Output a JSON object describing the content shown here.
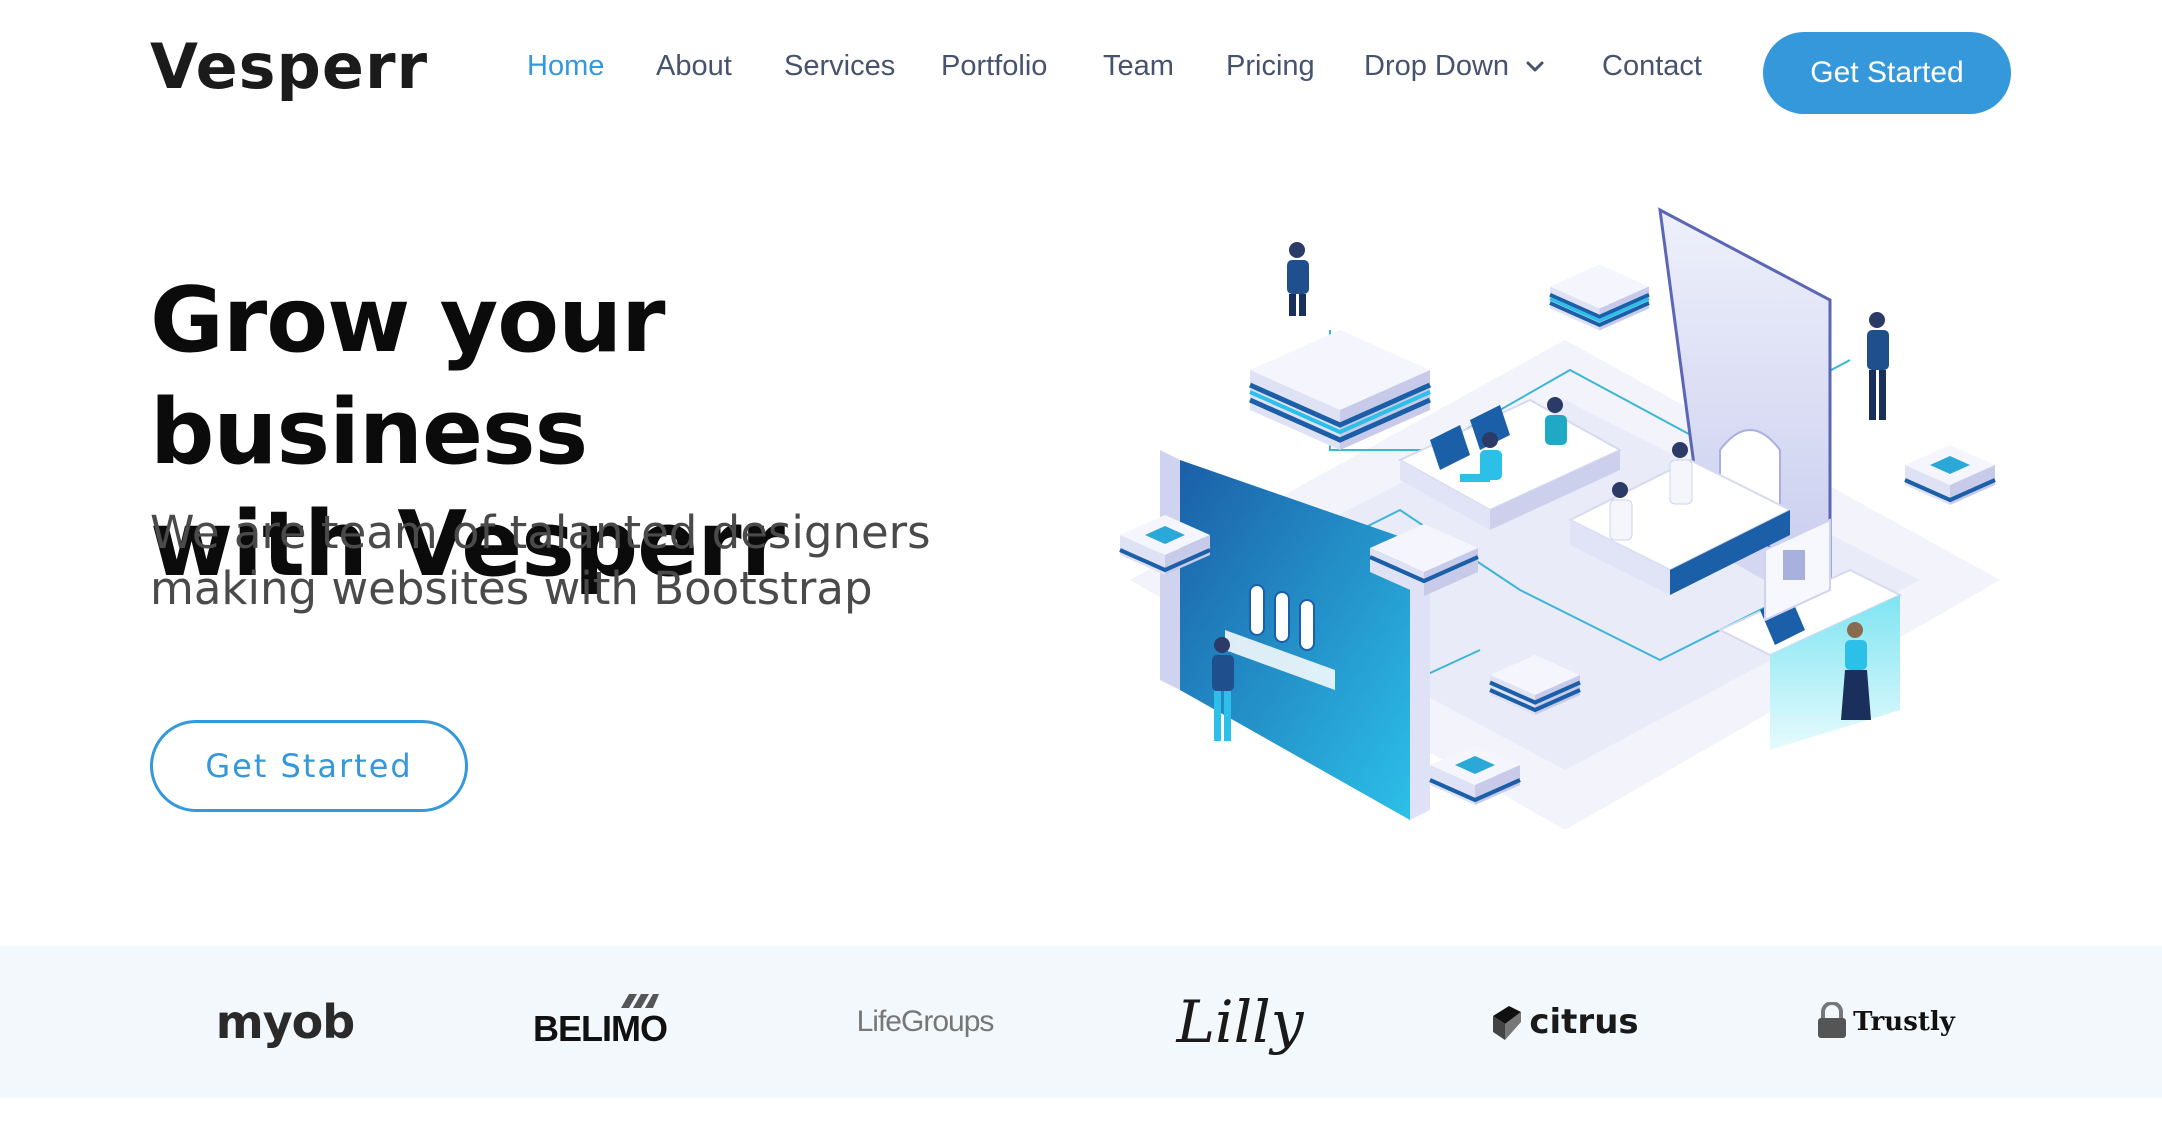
{
  "brand": {
    "name": "Vesperr",
    "accent": "#3498db"
  },
  "nav": {
    "items": [
      {
        "label": "Home",
        "active": true
      },
      {
        "label": "About"
      },
      {
        "label": "Services"
      },
      {
        "label": "Portfolio"
      },
      {
        "label": "Team"
      },
      {
        "label": "Pricing"
      },
      {
        "label": "Drop Down",
        "icon": "chevron-down-icon"
      },
      {
        "label": "Contact"
      }
    ],
    "cta_label": "Get Started"
  },
  "hero": {
    "title_line1": "Grow your business",
    "title_line2": "with Vesperr",
    "subtitle_line1": "We are team of talanted designers",
    "subtitle_line2": "making websites with Bootstrap",
    "cta_label": "Get Started"
  },
  "clients": {
    "logos": [
      {
        "name": "myob"
      },
      {
        "name": "BELIMO"
      },
      {
        "name": "LifeGroups"
      },
      {
        "name": "Lilly"
      },
      {
        "name": "citrus"
      },
      {
        "name": "Trustly"
      }
    ]
  }
}
